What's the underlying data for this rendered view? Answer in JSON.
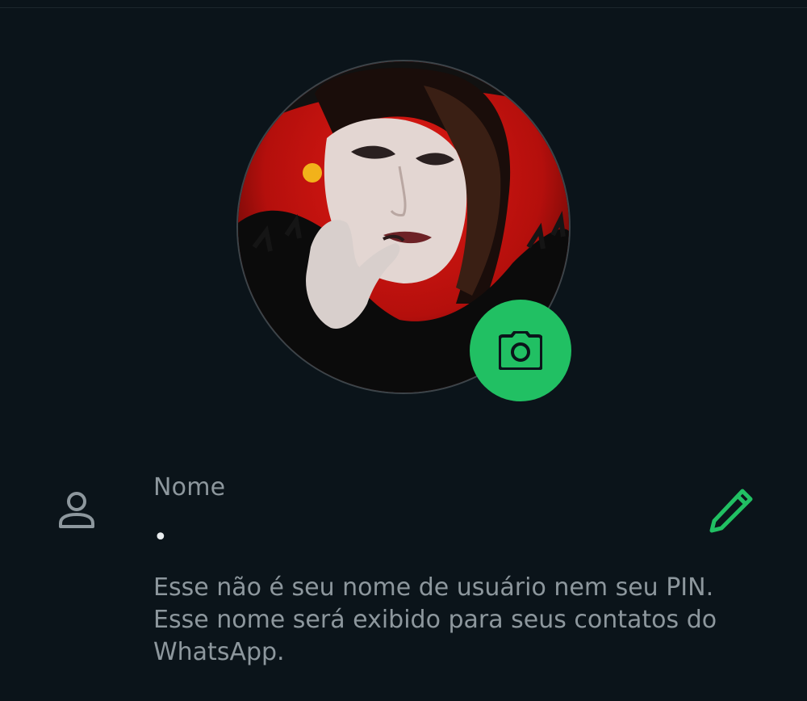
{
  "profile": {
    "photo_alt": "profile-photo",
    "camera_icon": "camera-icon",
    "accent_color": "#21c063"
  },
  "name_row": {
    "person_icon": "person-icon",
    "label": "Nome",
    "value": "•",
    "edit_icon": "pencil-icon"
  },
  "hint": {
    "text": "Esse não é seu nome de usuário nem seu PIN. Esse nome será exibido para seus contatos do WhatsApp."
  }
}
